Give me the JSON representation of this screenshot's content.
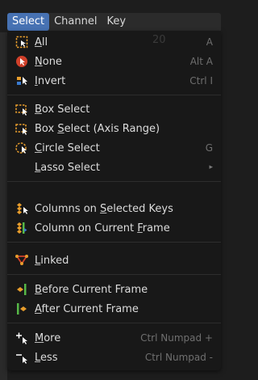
{
  "menubar": {
    "items": [
      "Select",
      "Channel",
      "Key"
    ]
  },
  "ghost_text": "20",
  "menu": {
    "all": {
      "prefix": "",
      "underline": "A",
      "rest": "ll",
      "shortcut": "A"
    },
    "none": {
      "underline": "N",
      "rest": "one",
      "shortcut": "Alt A"
    },
    "invert": {
      "underline": "I",
      "rest": "nvert",
      "shortcut": "Ctrl I"
    },
    "box_select": {
      "underline": "B",
      "rest": "ox Select"
    },
    "box_select_axis": {
      "pre": "Box ",
      "underline": "S",
      "rest": "elect (Axis Range)"
    },
    "circle_select": {
      "underline": "C",
      "rest": "ircle Select",
      "shortcut": "G"
    },
    "lasso_select": {
      "underline": "L",
      "rest": "asso Select",
      "submenu": "▸"
    },
    "columns_selected": {
      "pre": "Columns on ",
      "underline": "S",
      "rest": "elected Keys"
    },
    "column_current": {
      "pre": "Column on Current ",
      "underline": "F",
      "rest": "rame"
    },
    "linked": {
      "underline": "L",
      "rest": "inked"
    },
    "before_current": {
      "underline": "B",
      "rest": "efore Current Frame"
    },
    "after_current": {
      "underline": "A",
      "rest": "fter Current Frame"
    },
    "more": {
      "underline": "M",
      "rest": "ore",
      "shortcut": "Ctrl Numpad +"
    },
    "less": {
      "underline": "L",
      "rest": "ess",
      "shortcut": "Ctrl Numpad -"
    }
  },
  "colors": {
    "accent": "#4772b3",
    "menu_bg": "#181818",
    "shortcut": "#6f6f6f",
    "icon_orange": "#e89d2c",
    "icon_red": "#d0402a",
    "icon_blue": "#3a7bd0",
    "icon_green": "#56b847"
  }
}
